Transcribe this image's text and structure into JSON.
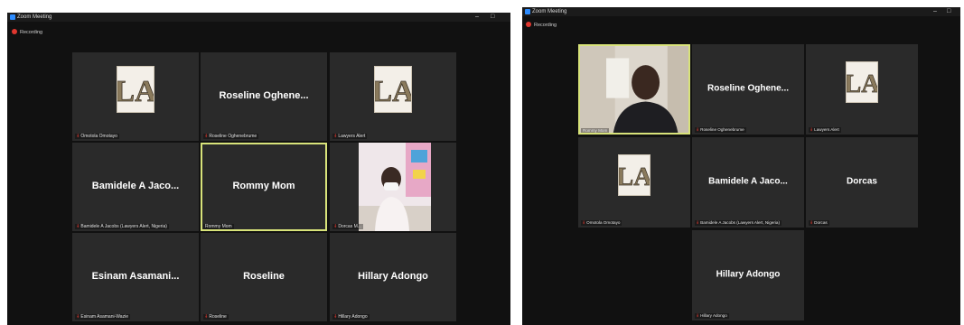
{
  "left": {
    "window_title": "Zoom Meeting",
    "recording_label": "Recording",
    "tiles": [
      {
        "name": "Omotola Omotayo",
        "big": "",
        "muted": true,
        "kind": "logo",
        "logo_text": "LA"
      },
      {
        "name": "Roseline Oghenebrume",
        "big": "Roseline  Oghene...",
        "muted": true,
        "kind": "text"
      },
      {
        "name": "Lawyers Alert",
        "big": "",
        "muted": true,
        "kind": "logo",
        "logo_text": "LA"
      },
      {
        "name": "Bamidele A Jacobs (Lawyers Alert, Nigeria)",
        "big": "Bamidele A Jaco...",
        "muted": true,
        "kind": "text"
      },
      {
        "name": "Rommy Mom",
        "big": "Rommy Mom",
        "muted": false,
        "kind": "text",
        "active": true
      },
      {
        "name": "Dorcas M...",
        "big": "",
        "muted": true,
        "kind": "video"
      },
      {
        "name": "Esinam Asamani-Wazie",
        "big": "Esinam  Asamani...",
        "muted": true,
        "kind": "text"
      },
      {
        "name": "Roseline",
        "big": "Roseline",
        "muted": true,
        "kind": "text"
      },
      {
        "name": "Hillary Adongo",
        "big": "Hillary Adongo",
        "muted": true,
        "kind": "text"
      }
    ]
  },
  "right": {
    "window_title": "Zoom Meeting",
    "recording_label": "Recording",
    "tiles": [
      {
        "name": "Rommy Mom",
        "big": "",
        "muted": false,
        "kind": "video",
        "active": true
      },
      {
        "name": "Roseline Oghenebrume",
        "big": "Roseline  Oghene...",
        "muted": true,
        "kind": "text"
      },
      {
        "name": "Lawyers Alert",
        "big": "",
        "muted": true,
        "kind": "logo",
        "logo_text": "LA"
      },
      {
        "name": "Omotola Omotayo",
        "big": "",
        "muted": true,
        "kind": "logo",
        "logo_text": "LA"
      },
      {
        "name": "Bamidele A Jacobs (Lawyers Alert, Nigeria)",
        "big": "Bamidele A Jaco...",
        "muted": true,
        "kind": "text"
      },
      {
        "name": "Dorcas",
        "big": "Dorcas",
        "muted": true,
        "kind": "text"
      },
      {
        "name": "Hillary Adongo",
        "big": "Hillary Adongo",
        "muted": true,
        "kind": "text"
      }
    ]
  },
  "window_controls": {
    "minimize": "–",
    "maximize": "□",
    "close": "×"
  },
  "mic_icon": "muted-mic-icon",
  "accent_active": "#d8e37a",
  "mute_color": "#e0372f"
}
